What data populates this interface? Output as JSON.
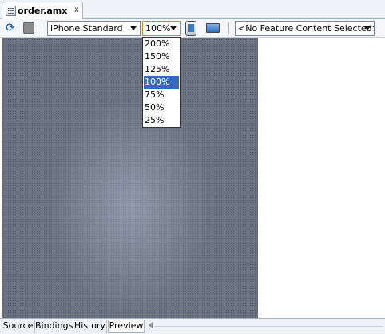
{
  "file_tab": {
    "name": "order.amx",
    "close": "x",
    "icon": "amx-file-icon"
  },
  "toolbar": {
    "refresh_icon": "refresh-icon",
    "stop_icon": "stop-icon",
    "device_combo": "iPhone Standard",
    "zoom_combo": "100%",
    "device_preview_icon": "phone-icon",
    "screen_icon": "screen-icon",
    "feature_combo": "<No Feature Content Selected>"
  },
  "zoom_dropdown": {
    "options": [
      "200%",
      "150%",
      "125%",
      "100%",
      "75%",
      "50%",
      "25%"
    ],
    "selected": "100%",
    "selected_color": "#316ac5"
  },
  "bottom_tabs": {
    "items": [
      "Source",
      "Bindings",
      "History",
      "Preview"
    ],
    "active": "Preview"
  }
}
